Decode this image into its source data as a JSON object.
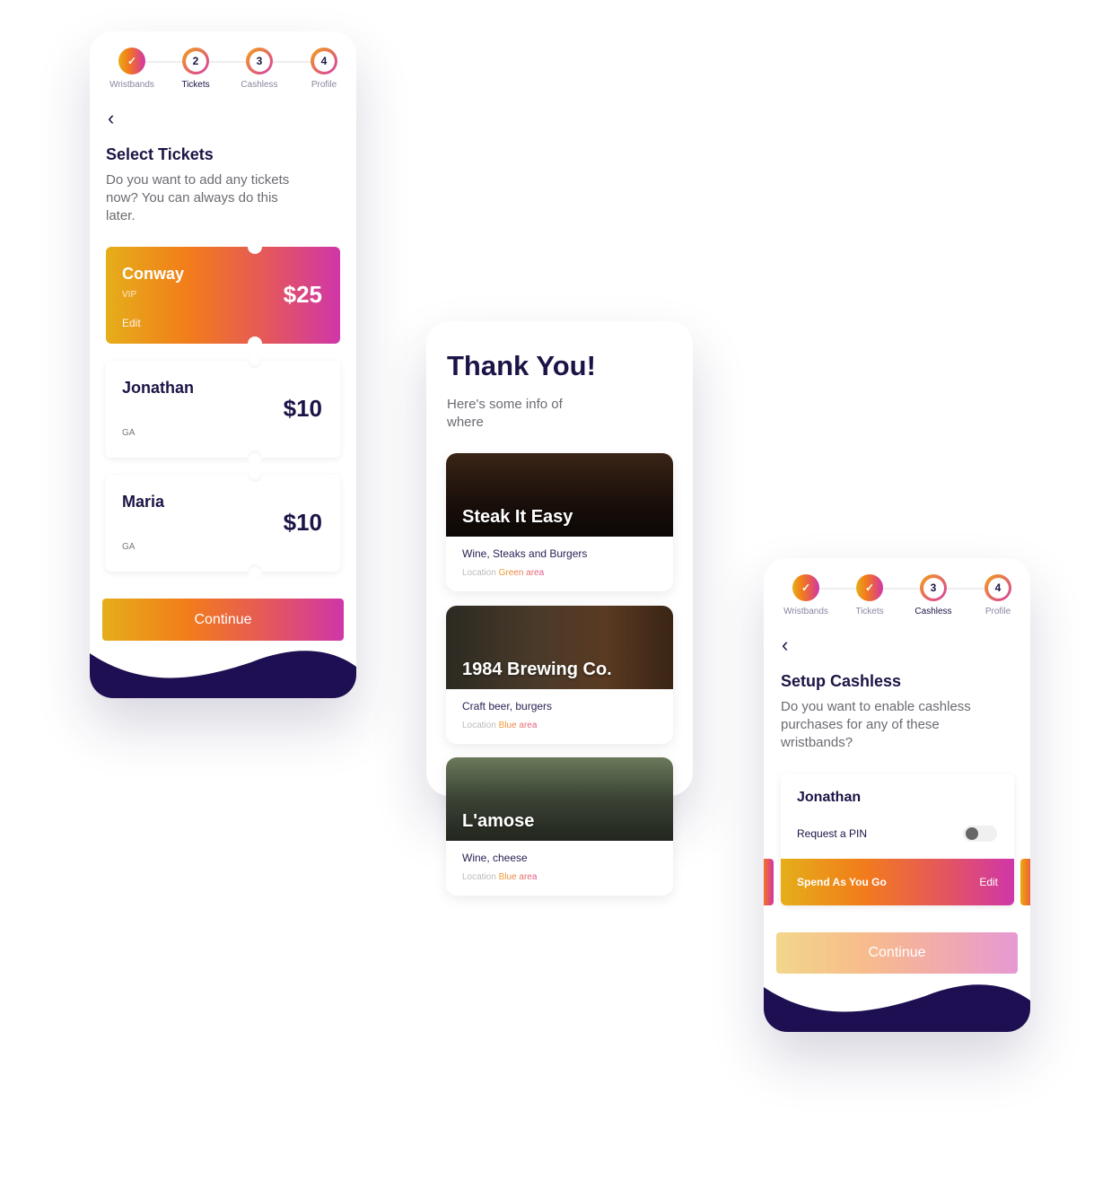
{
  "colors": {
    "navy": "#1c1446",
    "gradient": [
      "#e5ae1a",
      "#f27d1a",
      "#e4565e",
      "#cf36a9"
    ],
    "wave": "#1e0f52"
  },
  "stepper_labels": [
    "Wristbands",
    "Tickets",
    "Cashless",
    "Profile"
  ],
  "stepper_numbers": [
    "2",
    "3",
    "4"
  ],
  "tickets_screen": {
    "step_numbers": [
      "2",
      "3",
      "4"
    ],
    "title": "Select Tickets",
    "subtitle": "Do you want to add any tickets now? You can always do this later.",
    "tickets": [
      {
        "name": "Conway",
        "type": "VIP",
        "price": "$25",
        "edit": "Edit"
      },
      {
        "name": "Jonathan",
        "type": "GA",
        "price": "$10"
      },
      {
        "name": "Maria",
        "type": "GA",
        "price": "$10"
      }
    ],
    "continue": "Continue"
  },
  "thanks_screen": {
    "title": "Thank You!",
    "subtitle": "Here's some info of where",
    "location_label": "Location",
    "venues": [
      {
        "name": "Steak It Easy",
        "desc": "Wine, Steaks and Burgers",
        "area": "Green area"
      },
      {
        "name": "1984 Brewing Co.",
        "desc": "Craft beer, burgers",
        "area": "Blue area"
      },
      {
        "name": "L'amose",
        "desc": "Wine, cheese",
        "area": "Blue area"
      }
    ]
  },
  "cashless_screen": {
    "step_numbers": [
      "3",
      "4"
    ],
    "title": "Setup Cashless",
    "subtitle": "Do you want to enable cashless purchases for any of these wristbands?",
    "card": {
      "name": "Jonathan",
      "pin_label": "Request a PIN",
      "pin_enabled": false,
      "plan": "Spend As You Go",
      "edit": "Edit"
    },
    "continue": "Continue"
  }
}
